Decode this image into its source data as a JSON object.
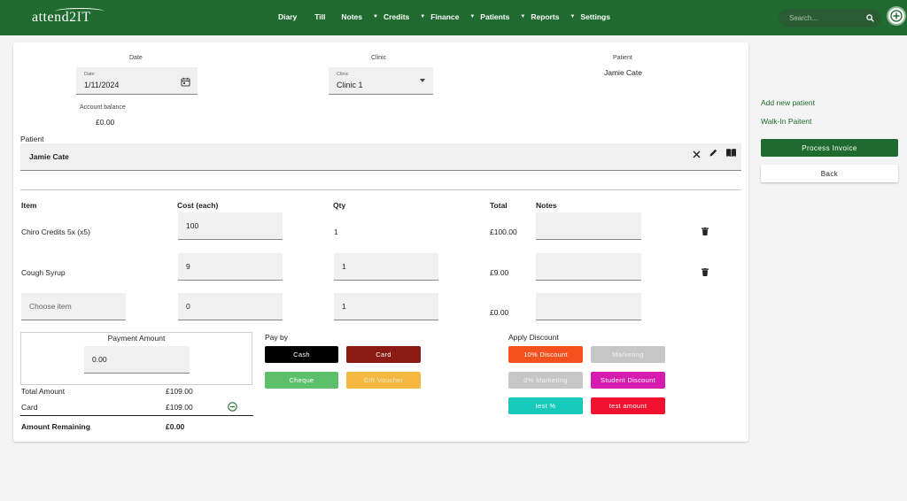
{
  "brand": {
    "logo_text": "attend2IT"
  },
  "nav": {
    "items": [
      {
        "label": "Diary",
        "caret": false
      },
      {
        "label": "Till",
        "caret": false
      },
      {
        "label": "Notes",
        "caret": true
      },
      {
        "label": "Credits",
        "caret": true
      },
      {
        "label": "Finance",
        "caret": true
      },
      {
        "label": "Patients",
        "caret": true
      },
      {
        "label": "Reports",
        "caret": true
      },
      {
        "label": "Settings",
        "caret": false
      }
    ],
    "search_placeholder": "Search...",
    "search_icon": "search-icon",
    "add_icon": "plus-circle-icon"
  },
  "header": {
    "date_label": "Date",
    "date_field_label": "Date",
    "date_value": "1/11/2024",
    "clinic_label": "Clinic",
    "clinic_field_label": "Clinic",
    "clinic_value": "Clinic 1",
    "patient_label": "Patient",
    "patient_value": "Jamie Cate",
    "balance_label": "Account balance",
    "balance_value": "£0.00"
  },
  "patient_section": {
    "label": "Patient",
    "name": "Jamie Cate",
    "icons": [
      "close-icon",
      "edit-icon",
      "book-icon"
    ]
  },
  "table": {
    "headers": {
      "item": "Item",
      "cost": "Cost (each)",
      "qty": "Qty",
      "total": "Total",
      "notes": "Notes"
    },
    "rows": [
      {
        "item": "Chiro Credits 5x (x5)",
        "cost": "100",
        "qty": "1",
        "total": "£100.00",
        "notes": ""
      },
      {
        "item": "Cough Syrup",
        "cost": "9",
        "qty": "1",
        "total": "£9.00",
        "notes": ""
      },
      {
        "item_placeholder": "Choose item",
        "cost": "0",
        "qty": "1",
        "total": "£0.00",
        "notes": ""
      }
    ]
  },
  "payment": {
    "box_title": "Payment Amount",
    "amount_value": "0.00",
    "total_label": "Total Amount",
    "total_value": "£109.00",
    "card_label": "Card",
    "card_value": "£109.00",
    "remaining_label": "Amount Remaining",
    "remaining_value": "£0.00"
  },
  "pay_by": {
    "title": "Pay by",
    "buttons": [
      {
        "label": "Cash",
        "bg": "#000000",
        "fg": "#ffffff"
      },
      {
        "label": "Card",
        "bg": "#8b1a14",
        "fg": "#ffffff"
      },
      {
        "label": "Cheque",
        "bg": "#5cc06a",
        "fg": "#ffffff"
      },
      {
        "label": "Gift Voucher",
        "bg": "#f5b942",
        "fg": "#f5e6c4"
      }
    ]
  },
  "discount": {
    "title": "Apply Discount",
    "buttons": [
      {
        "label": "10% Discount",
        "bg": "#f4511e",
        "fg": "#ffffff"
      },
      {
        "label": "Marketing",
        "bg": "#c6c6c6",
        "fg": "#f2f2f2"
      },
      {
        "label": "0% Marketing",
        "bg": "#c6c6c6",
        "fg": "#f2f2f2"
      },
      {
        "label": "Student Discount",
        "bg": "#d81bb0",
        "fg": "#ffffff"
      },
      {
        "label": "test %",
        "bg": "#19c9bb",
        "fg": "#ffffff"
      },
      {
        "label": "test amount",
        "bg": "#f0112f",
        "fg": "#ffffff"
      }
    ]
  },
  "sidebar": {
    "add_patient": "Add new patient",
    "walk_in": "Walk-In Paitent",
    "process_label": "Process Invoice",
    "back_label": "Back",
    "accent": "#1f6b2f"
  }
}
